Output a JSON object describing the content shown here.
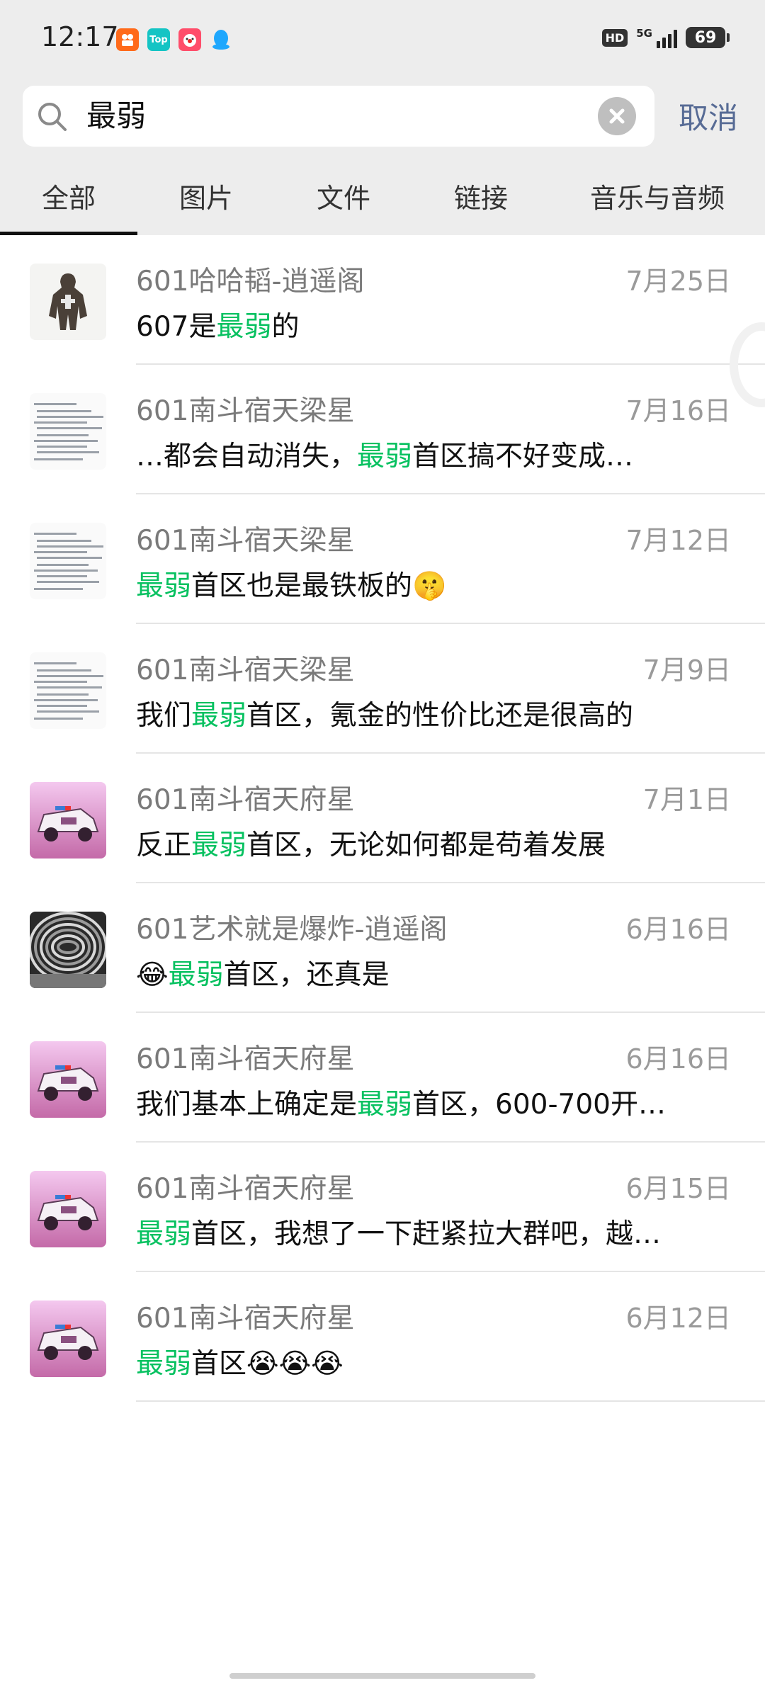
{
  "status_bar": {
    "time": "12:17",
    "apps": [
      "kuaishou-icon",
      "top-icon",
      "clown-icon",
      "qq-icon"
    ],
    "hd": "HD",
    "network": "5G",
    "battery": "69"
  },
  "search": {
    "query": "最弱",
    "cancel_label": "取消"
  },
  "tabs": [
    {
      "label": "全部",
      "active": true
    },
    {
      "label": "图片"
    },
    {
      "label": "文件"
    },
    {
      "label": "链接"
    },
    {
      "label": "音乐与音频"
    }
  ],
  "results": [
    {
      "name": "601哈哈韬-逍遥阁",
      "date": "7月25日",
      "pre": "607是",
      "hl": "最弱",
      "post": "的",
      "avatar": "knight"
    },
    {
      "name": "601南斗宿天梁星",
      "date": "7月16日",
      "pre": "…都会自动消失，",
      "hl": "最弱",
      "post": "首区搞不好变成…",
      "avatar": "doc"
    },
    {
      "name": "601南斗宿天梁星",
      "date": "7月12日",
      "pre": "",
      "hl": "最弱",
      "post": "首区也是最铁板的🤫",
      "avatar": "doc"
    },
    {
      "name": "601南斗宿天梁星",
      "date": "7月9日",
      "pre": "我们",
      "hl": "最弱",
      "post": "首区，氪金的性价比还是很高的",
      "avatar": "doc"
    },
    {
      "name": "601南斗宿天府星",
      "date": "7月1日",
      "pre": "反正",
      "hl": "最弱",
      "post": "首区，无论如何都是苟着发展",
      "avatar": "car"
    },
    {
      "name": "601艺术就是爆炸-逍遥阁",
      "date": "6月16日",
      "pre": "😂",
      "hl": "最弱",
      "post": "首区，还真是",
      "avatar": "tunnel"
    },
    {
      "name": "601南斗宿天府星",
      "date": "6月16日",
      "pre": "我们基本上确定是",
      "hl": "最弱",
      "post": "首区，600-700开…",
      "avatar": "car"
    },
    {
      "name": "601南斗宿天府星",
      "date": "6月15日",
      "pre": "",
      "hl": "最弱",
      "post": "首区，我想了一下赶紧拉大群吧，越…",
      "avatar": "car"
    },
    {
      "name": "601南斗宿天府星",
      "date": "6月12日",
      "pre": "",
      "hl": "最弱",
      "post": "首区😭😭😭",
      "avatar": "car"
    }
  ]
}
